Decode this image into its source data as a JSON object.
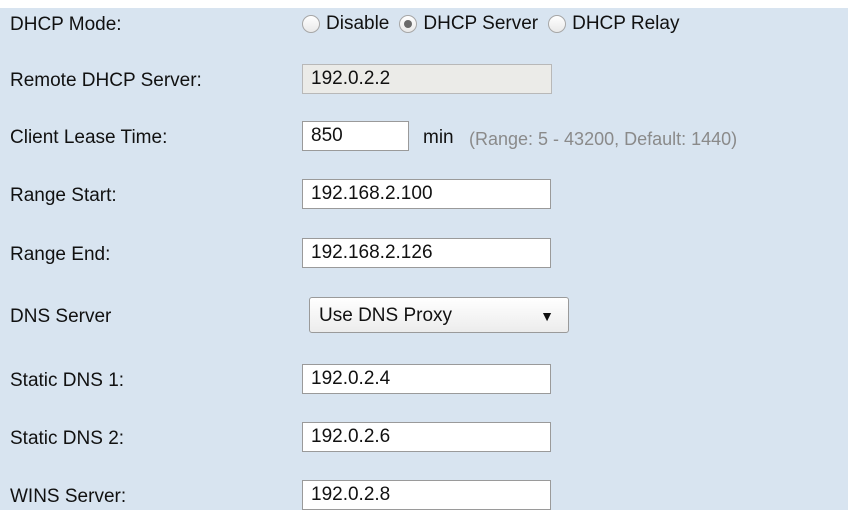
{
  "dhcp_mode": {
    "label": "DHCP Mode:",
    "options": [
      {
        "label": "Disable",
        "checked": false
      },
      {
        "label": "DHCP Server",
        "checked": true
      },
      {
        "label": "DHCP Relay",
        "checked": false
      }
    ]
  },
  "remote_dhcp_server": {
    "label": "Remote DHCP Server:",
    "value": "192.0.2.2",
    "disabled": true
  },
  "client_lease_time": {
    "label": "Client Lease Time:",
    "value": "850",
    "unit": "min",
    "hint": "(Range: 5 - 43200, Default: 1440)"
  },
  "range_start": {
    "label": "Range Start:",
    "value": "192.168.2.100"
  },
  "range_end": {
    "label": "Range End:",
    "value": "192.168.2.126"
  },
  "dns_server": {
    "label": "DNS Server",
    "selected": "Use DNS Proxy"
  },
  "static_dns_1": {
    "label": "Static DNS 1:",
    "value": "192.0.2.4"
  },
  "static_dns_2": {
    "label": "Static DNS 2:",
    "value": "192.0.2.6"
  },
  "wins_server": {
    "label": "WINS Server:",
    "value": "192.0.2.8"
  }
}
